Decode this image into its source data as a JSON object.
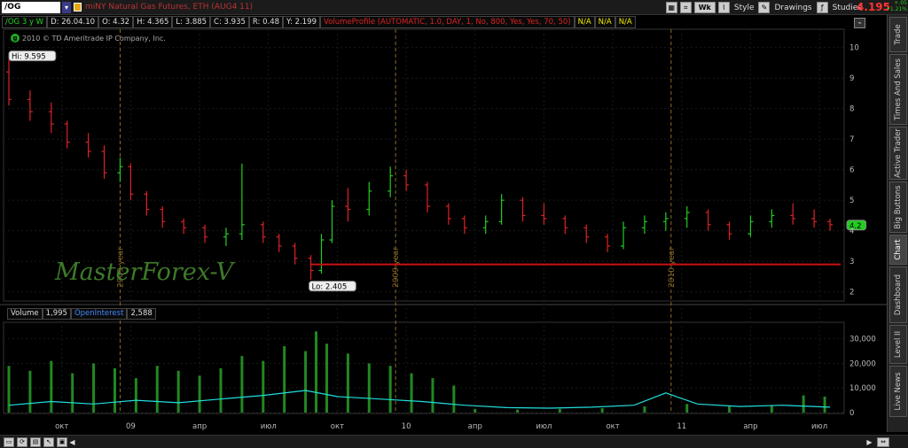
{
  "toolbar": {
    "symbol": "/OG",
    "description": "miNY Natural Gas Futures, ETH (AUG4 11)",
    "period_label": "Wk",
    "style_label": "Style",
    "drawings_label": "Drawings",
    "studies_label": "Studies",
    "last_price": "4.195",
    "change_abs": "+.05",
    "change_pct": "+1.21%"
  },
  "info_bar": {
    "aggregation": "/OG 3 y W",
    "date": "D: 26.04.10",
    "open": "O: 4.32",
    "high": "H: 4.365",
    "low": "L: 3.885",
    "close": "C: 3.935",
    "range": "R: 0.48",
    "ytd": "Y: 2.199",
    "volume_profile": "VolumeProfile (AUTOMATIC, 1.0, DAY, 1, No, 800, Yes, Yes, 70, 50)",
    "na1": "N/A",
    "na2": "N/A",
    "na3": "N/A"
  },
  "copyright": "2010 © TD Ameritrade IP Company, Inc.",
  "watermark": "MasterForex-V",
  "volume_header": {
    "label": "Volume",
    "value": "1,995",
    "oi_label": "OpenInterest",
    "oi_value": "2,588"
  },
  "right_tabs": [
    "Trade",
    "Times And Sales",
    "Active Trader",
    "Big Buttons",
    "Chart",
    "Dashboard",
    "Level II",
    "Live News"
  ],
  "colors": {
    "up": "#22cc22",
    "down": "#dd2222",
    "support": "#cc1111",
    "open_interest": "#22dddd",
    "volume": "#228822",
    "separator": "#8a6a2a"
  },
  "chart_data": {
    "type": "ohlc",
    "price_axis": {
      "ticks": [
        "10",
        "9",
        "8",
        "7",
        "6",
        "5",
        "4",
        "3",
        "2"
      ],
      "values": [
        10,
        9,
        8,
        7,
        6,
        5,
        4,
        3,
        2
      ],
      "ylim": [
        1.7,
        10.6
      ]
    },
    "x_ticks": [
      "окт",
      "09",
      "апр",
      "июл",
      "окт",
      "10",
      "апр",
      "июл",
      "окт",
      "11",
      "апр",
      "июл"
    ],
    "x_tick_weeks": [
      10,
      23,
      36,
      49,
      62,
      75,
      88,
      101,
      114,
      127,
      140,
      153
    ],
    "year_separators": [
      {
        "label": "2009 year",
        "week": 21
      },
      {
        "label": "2009 year",
        "week": 73
      },
      {
        "label": "2010 year",
        "week": 125
      }
    ],
    "hi_label": "Hi: 9.595",
    "lo_label": "Lo: 2.405",
    "hi_value": 9.595,
    "lo_value": 2.405,
    "current_label": "4.2",
    "current_value": 4.2,
    "support_level": 2.9,
    "series": [
      {
        "week": 0,
        "ohlc": [
          9.2,
          9.6,
          8.1,
          8.3
        ]
      },
      {
        "week": 4,
        "ohlc": [
          8.3,
          8.6,
          7.6,
          7.9
        ]
      },
      {
        "week": 8,
        "ohlc": [
          7.9,
          8.2,
          7.2,
          7.5
        ]
      },
      {
        "week": 11,
        "ohlc": [
          7.5,
          7.6,
          6.7,
          6.9
        ]
      },
      {
        "week": 15,
        "ohlc": [
          6.9,
          7.2,
          6.4,
          6.6
        ]
      },
      {
        "week": 18,
        "ohlc": [
          6.6,
          6.8,
          5.7,
          5.9
        ]
      },
      {
        "week": 21,
        "ohlc": [
          5.9,
          6.4,
          5.6,
          6.1
        ]
      },
      {
        "week": 23,
        "ohlc": [
          6.1,
          6.2,
          5.0,
          5.2
        ]
      },
      {
        "week": 26,
        "ohlc": [
          5.2,
          5.3,
          4.5,
          4.7
        ]
      },
      {
        "week": 29,
        "ohlc": [
          4.7,
          4.8,
          4.1,
          4.3
        ]
      },
      {
        "week": 33,
        "ohlc": [
          4.3,
          4.4,
          3.9,
          4.1
        ]
      },
      {
        "week": 37,
        "ohlc": [
          4.1,
          4.2,
          3.6,
          3.8
        ]
      },
      {
        "week": 41,
        "ohlc": [
          3.8,
          4.1,
          3.5,
          3.9
        ]
      },
      {
        "week": 44,
        "ohlc": [
          3.9,
          6.2,
          3.7,
          4.2
        ]
      },
      {
        "week": 48,
        "ohlc": [
          4.2,
          4.3,
          3.6,
          3.8
        ]
      },
      {
        "week": 51,
        "ohlc": [
          3.8,
          3.9,
          3.3,
          3.5
        ]
      },
      {
        "week": 54,
        "ohlc": [
          3.5,
          3.6,
          2.9,
          3.1
        ]
      },
      {
        "week": 57,
        "ohlc": [
          3.1,
          3.2,
          2.4,
          2.7
        ]
      },
      {
        "week": 59,
        "ohlc": [
          2.7,
          3.9,
          2.6,
          3.7
        ]
      },
      {
        "week": 61,
        "ohlc": [
          3.7,
          5.0,
          3.6,
          4.8
        ]
      },
      {
        "week": 64,
        "ohlc": [
          4.8,
          5.4,
          4.3,
          4.7
        ]
      },
      {
        "week": 68,
        "ohlc": [
          4.7,
          5.6,
          4.5,
          5.3
        ]
      },
      {
        "week": 72,
        "ohlc": [
          5.3,
          6.1,
          5.1,
          5.8
        ]
      },
      {
        "week": 75,
        "ohlc": [
          5.8,
          6.0,
          5.3,
          5.5
        ]
      },
      {
        "week": 79,
        "ohlc": [
          5.5,
          5.6,
          4.6,
          4.8
        ]
      },
      {
        "week": 83,
        "ohlc": [
          4.8,
          4.9,
          4.2,
          4.4
        ]
      },
      {
        "week": 86,
        "ohlc": [
          4.4,
          4.5,
          3.9,
          4.1
        ]
      },
      {
        "week": 90,
        "ohlc": [
          4.1,
          4.5,
          3.9,
          4.3
        ]
      },
      {
        "week": 93,
        "ohlc": [
          4.3,
          5.2,
          4.2,
          5.0
        ]
      },
      {
        "week": 97,
        "ohlc": [
          5.0,
          5.1,
          4.3,
          4.5
        ]
      },
      {
        "week": 101,
        "ohlc": [
          4.5,
          4.9,
          4.2,
          4.4
        ]
      },
      {
        "week": 105,
        "ohlc": [
          4.4,
          4.5,
          3.9,
          4.1
        ]
      },
      {
        "week": 109,
        "ohlc": [
          4.1,
          4.2,
          3.6,
          3.8
        ]
      },
      {
        "week": 113,
        "ohlc": [
          3.8,
          3.9,
          3.3,
          3.5
        ]
      },
      {
        "week": 116,
        "ohlc": [
          3.5,
          4.3,
          3.4,
          4.1
        ]
      },
      {
        "week": 120,
        "ohlc": [
          4.1,
          4.5,
          3.9,
          4.3
        ]
      },
      {
        "week": 124,
        "ohlc": [
          4.3,
          4.6,
          4.0,
          4.4
        ]
      },
      {
        "week": 128,
        "ohlc": [
          4.4,
          4.8,
          4.1,
          4.6
        ]
      },
      {
        "week": 132,
        "ohlc": [
          4.6,
          4.7,
          4.0,
          4.2
        ]
      },
      {
        "week": 136,
        "ohlc": [
          4.2,
          4.3,
          3.7,
          3.9
        ]
      },
      {
        "week": 140,
        "ohlc": [
          3.9,
          4.5,
          3.8,
          4.3
        ]
      },
      {
        "week": 144,
        "ohlc": [
          4.3,
          4.7,
          4.1,
          4.5
        ]
      },
      {
        "week": 148,
        "ohlc": [
          4.5,
          4.9,
          4.2,
          4.4
        ]
      },
      {
        "week": 152,
        "ohlc": [
          4.4,
          4.7,
          4.1,
          4.3
        ]
      },
      {
        "week": 155,
        "ohlc": [
          4.3,
          4.4,
          4.0,
          4.2
        ]
      }
    ],
    "volume_axis": {
      "ticks": [
        "30,000",
        "20,000",
        "10,000",
        "0"
      ],
      "values": [
        30000,
        20000,
        10000,
        0
      ],
      "ylim": [
        0,
        36000
      ]
    },
    "volume": [
      {
        "week": 0,
        "value": 19000
      },
      {
        "week": 4,
        "value": 17000
      },
      {
        "week": 8,
        "value": 21000
      },
      {
        "week": 12,
        "value": 16000
      },
      {
        "week": 16,
        "value": 20000
      },
      {
        "week": 20,
        "value": 18000
      },
      {
        "week": 24,
        "value": 14000
      },
      {
        "week": 28,
        "value": 19000
      },
      {
        "week": 32,
        "value": 17000
      },
      {
        "week": 36,
        "value": 15000
      },
      {
        "week": 40,
        "value": 18000
      },
      {
        "week": 44,
        "value": 23000
      },
      {
        "week": 48,
        "value": 21000
      },
      {
        "week": 52,
        "value": 27000
      },
      {
        "week": 56,
        "value": 25000
      },
      {
        "week": 58,
        "value": 33000
      },
      {
        "week": 60,
        "value": 28000
      },
      {
        "week": 64,
        "value": 24000
      },
      {
        "week": 68,
        "value": 20000
      },
      {
        "week": 72,
        "value": 19000
      },
      {
        "week": 76,
        "value": 16000
      },
      {
        "week": 80,
        "value": 14000
      },
      {
        "week": 84,
        "value": 11000
      },
      {
        "week": 88,
        "value": 1500
      },
      {
        "week": 96,
        "value": 1200
      },
      {
        "week": 104,
        "value": 1500
      },
      {
        "week": 112,
        "value": 1800
      },
      {
        "week": 120,
        "value": 2500
      },
      {
        "week": 128,
        "value": 3500
      },
      {
        "week": 136,
        "value": 2500
      },
      {
        "week": 144,
        "value": 3000
      },
      {
        "week": 150,
        "value": 7000
      },
      {
        "week": 154,
        "value": 6500
      }
    ],
    "open_interest": [
      {
        "week": 0,
        "value": 3000
      },
      {
        "week": 8,
        "value": 4500
      },
      {
        "week": 16,
        "value": 3500
      },
      {
        "week": 24,
        "value": 5000
      },
      {
        "week": 32,
        "value": 4000
      },
      {
        "week": 40,
        "value": 5500
      },
      {
        "week": 48,
        "value": 7000
      },
      {
        "week": 56,
        "value": 9000
      },
      {
        "week": 62,
        "value": 6500
      },
      {
        "week": 70,
        "value": 5500
      },
      {
        "week": 78,
        "value": 4500
      },
      {
        "week": 86,
        "value": 3000
      },
      {
        "week": 94,
        "value": 2000
      },
      {
        "week": 102,
        "value": 1800
      },
      {
        "week": 110,
        "value": 2200
      },
      {
        "week": 118,
        "value": 3000
      },
      {
        "week": 124,
        "value": 8000
      },
      {
        "week": 130,
        "value": 3500
      },
      {
        "week": 138,
        "value": 2500
      },
      {
        "week": 146,
        "value": 3000
      },
      {
        "week": 155,
        "value": 2200
      }
    ]
  }
}
